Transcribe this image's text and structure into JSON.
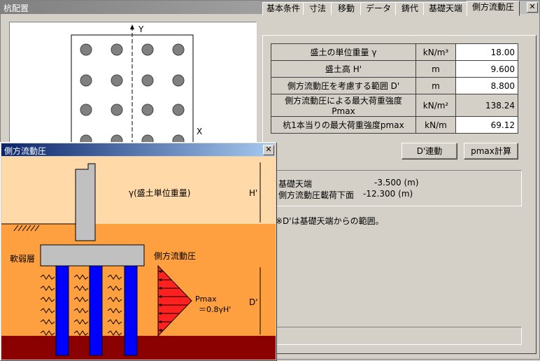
{
  "window": {
    "title": "杭配置",
    "close_label": "✕"
  },
  "plan": {
    "y_axis_label": "Y",
    "x_axis_label": "X"
  },
  "tabs": [
    {
      "label": "基本条件"
    },
    {
      "label": "寸法"
    },
    {
      "label": "移動"
    },
    {
      "label": "データ"
    },
    {
      "label": "鋳代"
    },
    {
      "label": "基礎天端"
    },
    {
      "label": "側方流動圧",
      "active": true
    }
  ],
  "table": {
    "rows": [
      {
        "label": "盛土の単位重量 γ",
        "unit": "kN/m³",
        "value": "18.00",
        "editable": true
      },
      {
        "label": "盛土高 H'",
        "unit": "m",
        "value": "9.600",
        "editable": true
      },
      {
        "label": "側方流動圧を考慮する範囲 D'",
        "unit": "m",
        "value": "8.800",
        "editable": true
      },
      {
        "label": "側方流動圧による最大荷重強度Pmax",
        "unit": "kN/m²",
        "value": "138.24",
        "editable": false
      },
      {
        "label": "杭1本当りの最大荷重強度pmax",
        "unit": "kN/m",
        "value": "69.12",
        "editable": true
      }
    ]
  },
  "buttons": {
    "d_link": "D'連動",
    "pmax_calc": "pmax計算"
  },
  "info": {
    "line1_label": "基礎天端",
    "line1_value": "-3.500 (m)",
    "line2_label": "側方流動圧載荷下面",
    "line2_value": "-12.300 (m)"
  },
  "note": "※D'は基礎天端からの範囲。",
  "popup": {
    "title": "側方流動圧",
    "close_label": "✕",
    "gamma_label": "γ(盛土単位重量)",
    "h_label": "H'",
    "soft_layer_label": "軟弱層",
    "lateral_label": "側方流動圧",
    "pmax_label": "Pmax",
    "pmax_formula": "＝0.8γH'",
    "d_label": "D'"
  },
  "colors": {
    "embankment": "#ffd9a8",
    "soil": "#ffa040",
    "base": "#8b0000",
    "pile": "#0000ff",
    "pressure": "#ff2020"
  }
}
